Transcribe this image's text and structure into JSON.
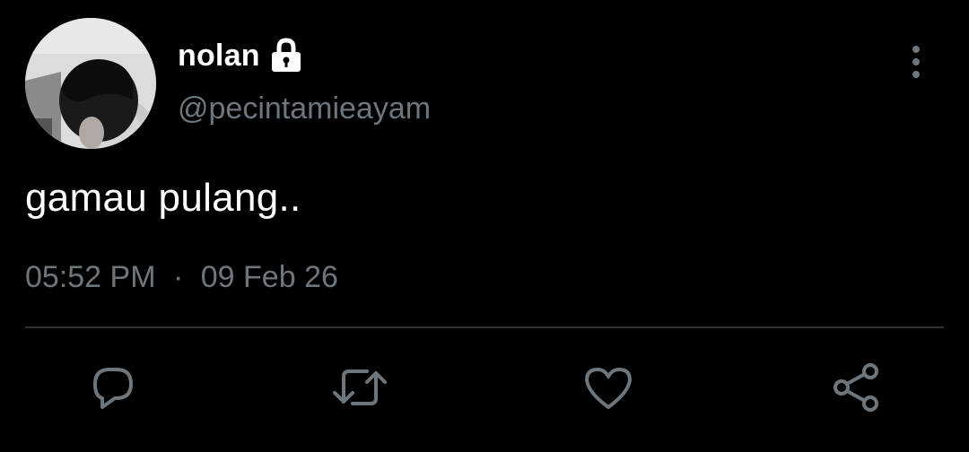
{
  "user": {
    "display_name": "nolan",
    "handle": "@pecintamieayam",
    "protected_icon": "lock-icon",
    "avatar": "profile-photo"
  },
  "tweet": {
    "text": "gamau pulang..",
    "time": "05:52 PM",
    "separator": "·",
    "date": "09 Feb 26"
  },
  "actions": [
    {
      "icon": "reply-icon"
    },
    {
      "icon": "retweet-icon"
    },
    {
      "icon": "like-icon"
    },
    {
      "icon": "share-icon"
    }
  ],
  "menu_icon": "more-vertical-icon",
  "colors": {
    "background": "#000000",
    "primary_text": "#ffffff",
    "secondary_text": "#6e767d",
    "divider": "#2f3336"
  }
}
